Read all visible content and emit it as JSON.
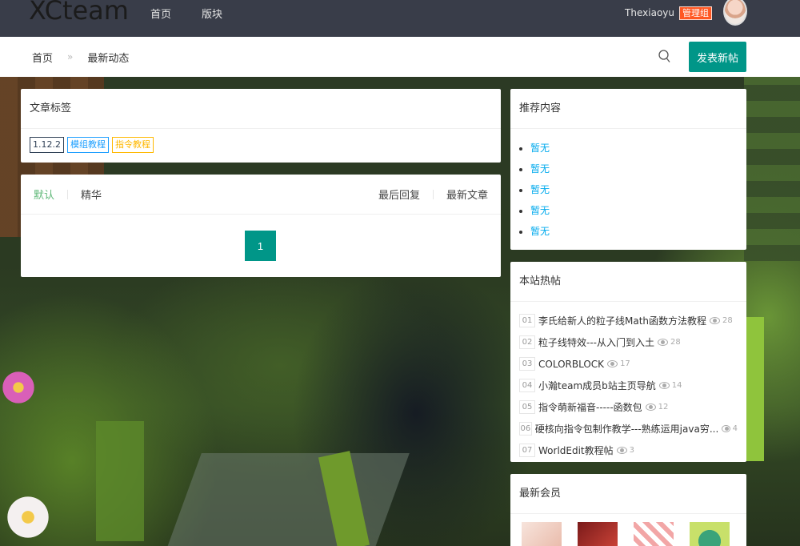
{
  "header": {
    "logo": "XCteam",
    "nav": [
      "首页",
      "版块"
    ],
    "username": "Thexiaoyu",
    "role_badge": "管理组"
  },
  "subbar": {
    "breadcrumb": [
      "首页",
      "最新动态"
    ],
    "breadcrumb_sep": "»",
    "post_button": "发表新帖"
  },
  "tags_panel": {
    "title": "文章标签",
    "tags": [
      {
        "label": "1.12.2",
        "color": "#2f4056"
      },
      {
        "label": "模组教程",
        "color": "#1e9fff"
      },
      {
        "label": "指令教程",
        "color": "#ffb800"
      }
    ]
  },
  "list_panel": {
    "tabs": [
      "默认",
      "精华"
    ],
    "sort": [
      "最后回复",
      "最新文章"
    ],
    "page": "1"
  },
  "recommend": {
    "title": "推荐内容",
    "items": [
      "暂无",
      "暂无",
      "暂无",
      "暂无",
      "暂无"
    ]
  },
  "hot": {
    "title": "本站热帖",
    "items": [
      {
        "num": "01",
        "title": "李氏给新人的粒子线Math函数方法教程",
        "views": "28"
      },
      {
        "num": "02",
        "title": "粒子线特效---从入门到入土",
        "views": "28"
      },
      {
        "num": "03",
        "title": "COLORBLOCK",
        "views": "17"
      },
      {
        "num": "04",
        "title": "小瀚team成员b站主页导航",
        "views": "14"
      },
      {
        "num": "05",
        "title": "指令萌新福音-----函数包",
        "views": "12"
      },
      {
        "num": "06",
        "title": "硬核向指令包制作教学---熟练运用java穷...",
        "views": "4"
      },
      {
        "num": "07",
        "title": "WorldEdit教程帖",
        "views": "3"
      }
    ]
  },
  "members": {
    "title": "最新会员"
  },
  "colors": {
    "accent": "#009688",
    "topbar": "#393d49",
    "link": "#01aaed",
    "active_tab": "#5fb878",
    "badge": "#ff5722"
  }
}
